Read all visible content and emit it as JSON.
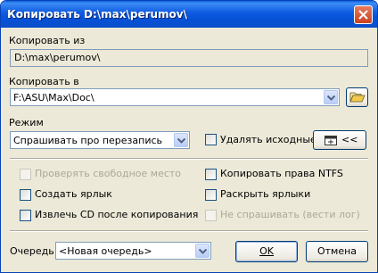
{
  "window": {
    "title": "Копировать D:\\max\\perumov\\"
  },
  "source": {
    "label": "Копировать из",
    "value": "D:\\max\\perumov\\"
  },
  "destination": {
    "label": "Копировать в",
    "value": "F:\\ASU\\Max\\Doc\\"
  },
  "mode": {
    "label": "Режим",
    "value": "Спрашивать про перезапись"
  },
  "delete_source": {
    "label": "Удалять исходные",
    "checked": false
  },
  "collapse_button": {
    "label": "<<"
  },
  "options": {
    "check_free_space": {
      "label": "Проверять свободное место",
      "checked": false,
      "enabled": false
    },
    "create_shortcut": {
      "label": "Создать ярлык",
      "checked": false,
      "enabled": true
    },
    "eject_cd": {
      "label": "Извлечь CD после копирования",
      "checked": false,
      "enabled": true
    },
    "copy_ntfs": {
      "label": "Копировать права NTFS",
      "checked": false,
      "enabled": true
    },
    "expand_shortcuts": {
      "label": "Раскрыть ярлыки",
      "checked": false,
      "enabled": true
    },
    "dont_ask": {
      "label": "Не спрашивать (вести лог)",
      "checked": false,
      "enabled": false
    }
  },
  "queue": {
    "label": "Очередь",
    "value": "<Новая очередь>"
  },
  "ok_button": {
    "label": "OK"
  },
  "cancel_button": {
    "label": "Отмена"
  },
  "colors": {
    "titlebar": "#0a5fe0",
    "dialog_bg": "#ece9d8",
    "close": "#c8411f"
  }
}
